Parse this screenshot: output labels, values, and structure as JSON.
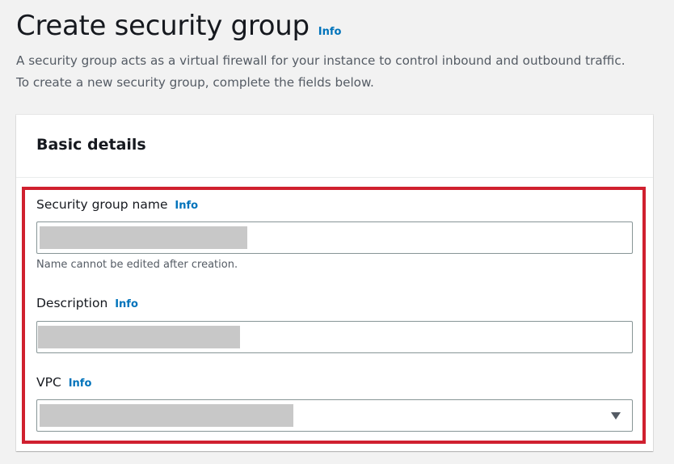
{
  "page": {
    "title": "Create security group",
    "info_label": "Info",
    "description_line1": "A security group acts as a virtual firewall for your instance to control inbound and outbound traffic.",
    "description_line2": "To create a new security group, complete the fields below."
  },
  "basic_details": {
    "title": "Basic details",
    "fields": {
      "name": {
        "label": "Security group name",
        "info": "Info",
        "value": "",
        "hint": "Name cannot be edited after creation."
      },
      "description": {
        "label": "Description",
        "info": "Info",
        "value": ""
      },
      "vpc": {
        "label": "VPC",
        "info": "Info",
        "value": "",
        "icon": "caret-down-icon"
      }
    }
  },
  "colors": {
    "link": "#0073bb",
    "highlight": "#d0202f",
    "background": "#f2f2f2"
  }
}
